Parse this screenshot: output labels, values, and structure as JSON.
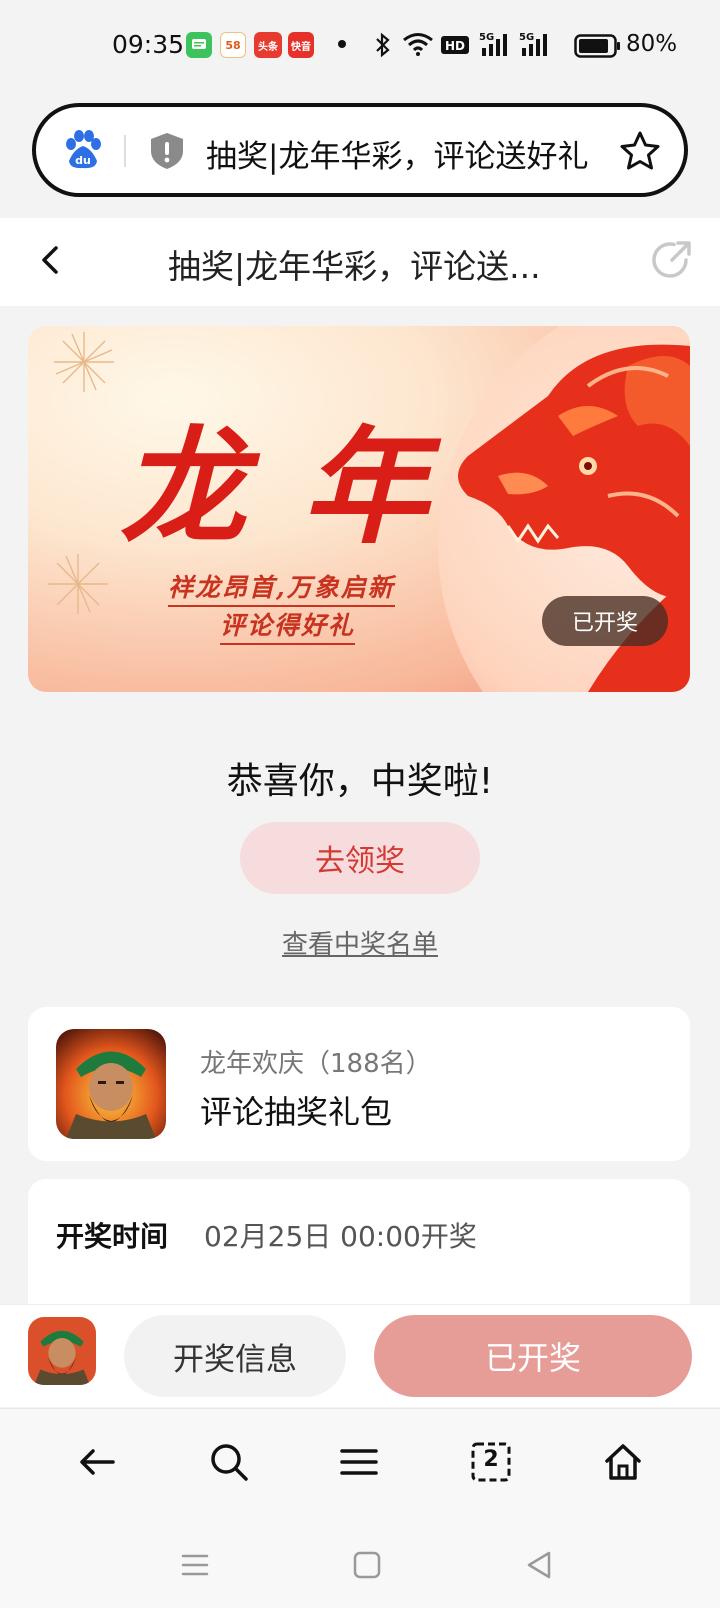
{
  "status_bar": {
    "time": "09:35",
    "apps": [
      {
        "name": "messages-icon",
        "label": "",
        "color": "#3cc35b"
      },
      {
        "name": "58-icon",
        "label": "58",
        "color": "#f0a020"
      },
      {
        "name": "toutiao-icon",
        "label": "头条",
        "color": "#e83b30"
      },
      {
        "name": "kuaiyin-icon",
        "label": "快音",
        "color": "#e5312a"
      }
    ],
    "battery": "80%"
  },
  "address_bar": {
    "title": "抽奖|龙年华彩，评论送好礼"
  },
  "page_header": {
    "title": "抽奖|龙年华彩，评论送..."
  },
  "banner": {
    "heading": "龙年",
    "line1": "祥龙昂首,万象启新",
    "line2": "评论得好礼",
    "badge": "已开奖",
    "colors": {
      "primary": "#d81e16",
      "dragon": "#e6301c"
    }
  },
  "result": {
    "congrats": "恭喜你，中奖啦!",
    "claim_button": "去领奖",
    "winners_link": "查看中奖名单"
  },
  "prize": {
    "subtitle": "龙年欢庆（188名）",
    "title": "评论抽奖礼包"
  },
  "draw_info": {
    "label": "开奖时间",
    "value": "02月25日 00:00开奖"
  },
  "action_bar": {
    "info_button": "开奖信息",
    "main_button": "已开奖",
    "colors": {
      "main": "#e79d97",
      "claim_bg": "#f6dcdc",
      "claim_text": "#d23b33"
    }
  },
  "toolbar": {
    "tab_count": "2",
    "icons": [
      "back-arrow-icon",
      "search-icon",
      "menu-icon",
      "tabs-icon",
      "home-icon"
    ]
  },
  "system_nav": {
    "icons": [
      "recent-apps-icon",
      "home-square-icon",
      "back-triangle-icon"
    ]
  }
}
